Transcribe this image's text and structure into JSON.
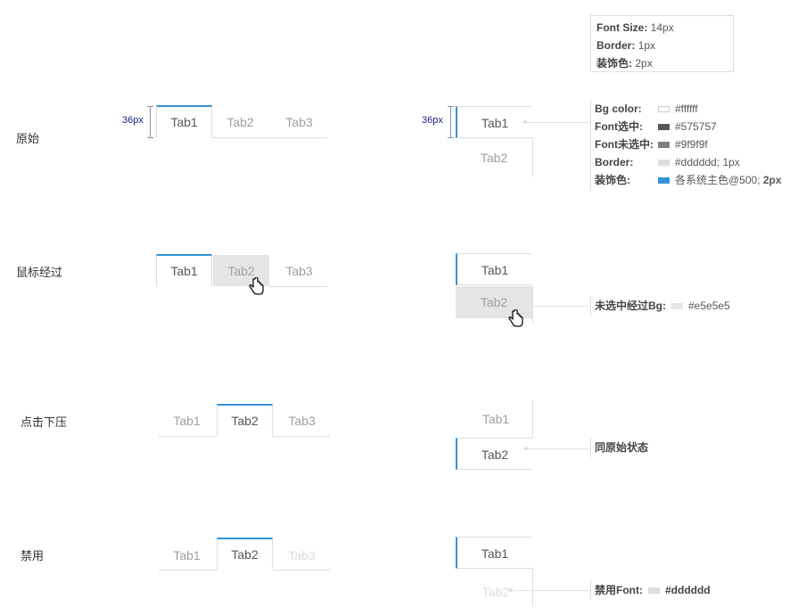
{
  "tabs": {
    "tab1": "Tab1",
    "tab2": "Tab2",
    "tab3": "Tab3"
  },
  "rows": {
    "original": "原始",
    "hover": "鼠标经过",
    "pressed": "点击下压",
    "disabled": "禁用"
  },
  "dimension": "36px",
  "spec": {
    "font_size_key": "Font Size:",
    "font_size_val": "14px",
    "border_key": "Border:",
    "border_val": "1px",
    "accent_key": "装饰色:",
    "accent_val": "2px"
  },
  "legend": [
    {
      "key": "Bg color:",
      "value": "#ffffff",
      "swatch": "#ffffff"
    },
    {
      "key": "Font选中:",
      "value": "#575757",
      "swatch": "#575757"
    },
    {
      "key": "Font未选中:",
      "value": "#9f9f9f",
      "swatch": "#7f7f7f"
    },
    {
      "key": "Border:",
      "value": "#dddddd; 1px",
      "swatch": "#dddddd"
    },
    {
      "key": "装饰色:",
      "value": "各系统主色@500; ",
      "value_bold": "2px",
      "swatch": "#3592d9"
    }
  ],
  "notes": {
    "hover_key": "未选中经过Bg:",
    "hover_val": "#e5e5e5",
    "hover_swatch": "#e5e5e5",
    "pressed": "同原始状态",
    "disabled_key": "禁用Font:",
    "disabled_val": "#dddddd",
    "disabled_swatch": "#dddddd"
  },
  "colors": {
    "accent": "#3592d9",
    "selected_font": "#575757",
    "unselected_font": "#9f9f9f",
    "border": "#dddddd",
    "hover_bg": "#e5e5e5",
    "disabled_font": "#dddddd"
  },
  "icons": [
    "hand-pointer-icon"
  ]
}
